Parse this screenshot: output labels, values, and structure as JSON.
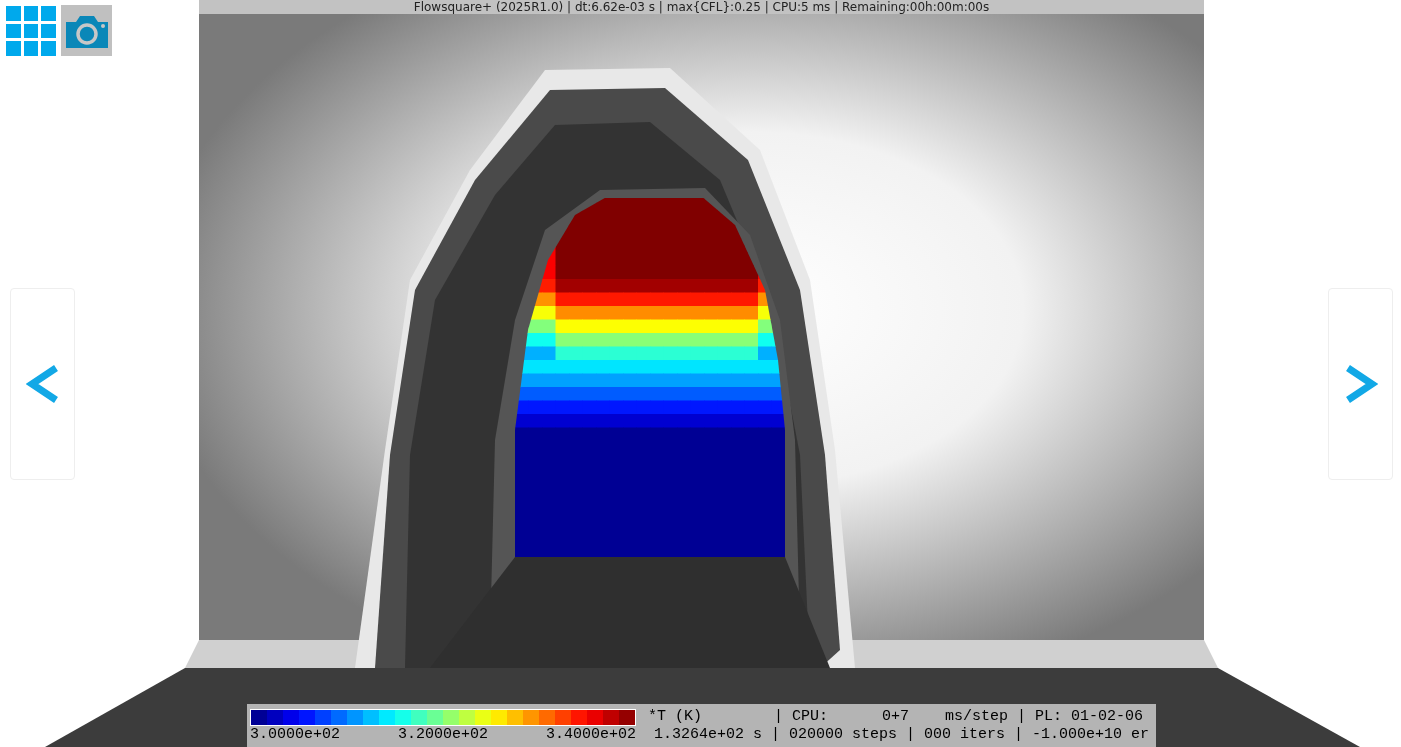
{
  "title_bar": {
    "text": "Flowsquare+ (2025R1.0) | dt:6.62e-03 s | max{CFL}:0.25 | CPU:5 ms | Remaining:00h:00m:00s"
  },
  "legend": {
    "colorbar_labels": [
      "3.0000e+02",
      "3.2000e+02",
      "3.4000e+02"
    ],
    "row_1": "*T (K)        | CPU:      0+7    ms/step | PL: 01-02-06",
    "row_2": "1.3264e+02 s | 020000 steps | 000 iters | -1.000e+10 er"
  }
}
